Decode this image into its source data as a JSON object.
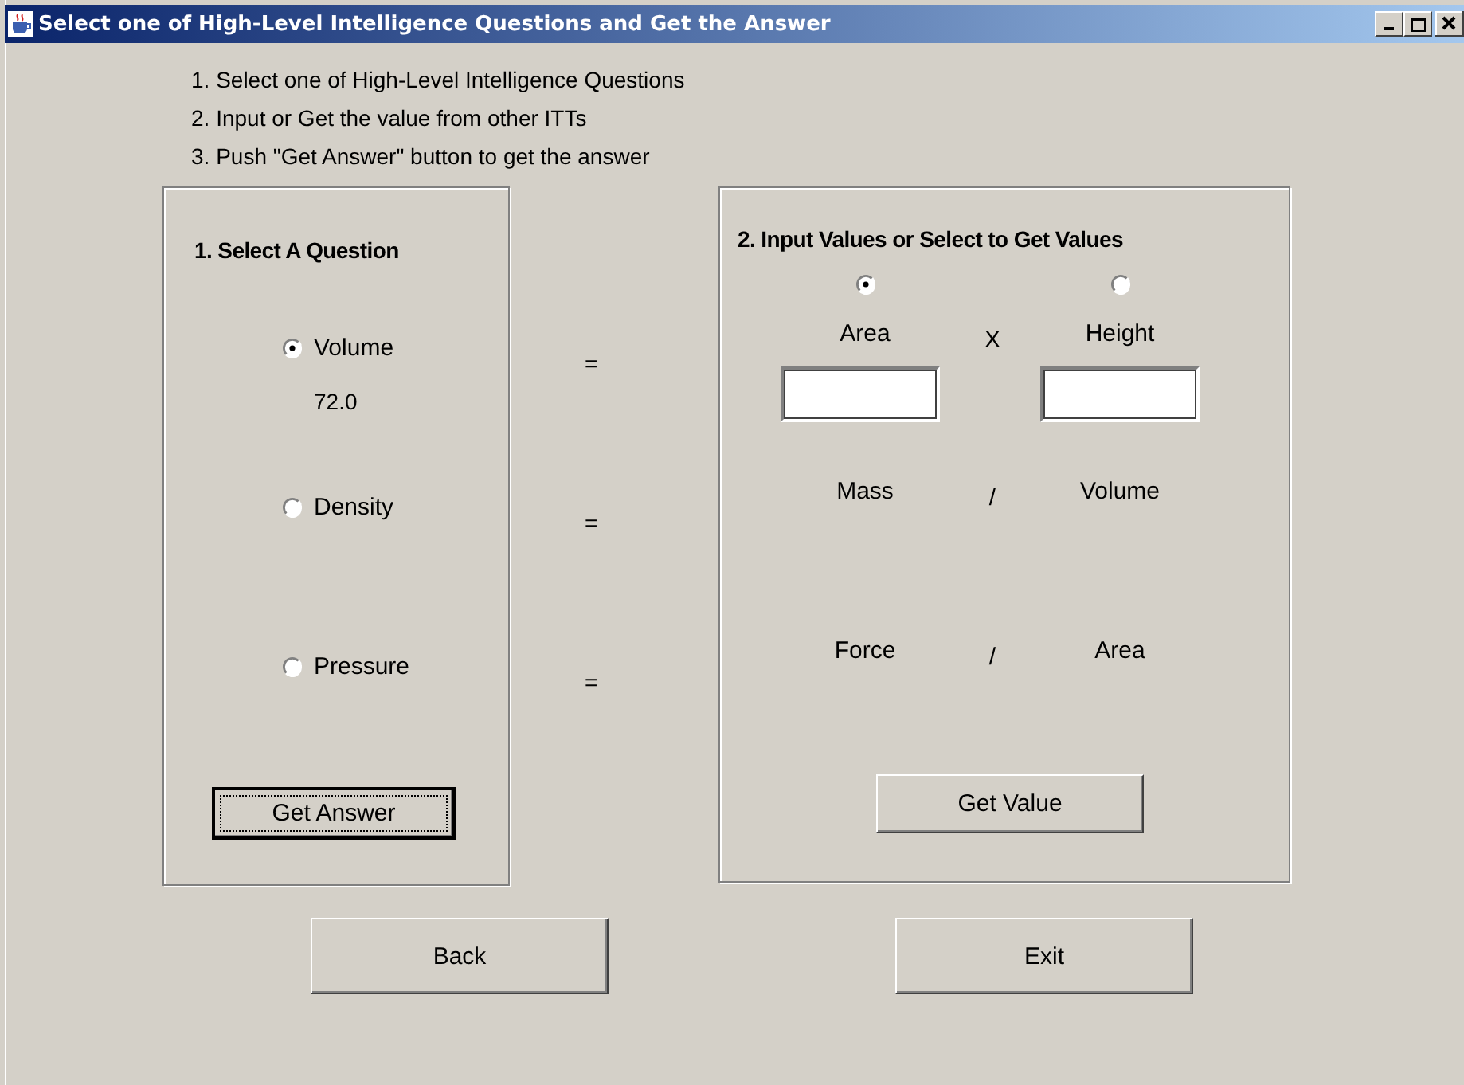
{
  "window": {
    "title": "Select one of High-Level Intelligence Questions and Get the Answer"
  },
  "instructions": [
    "1. Select one of High-Level Intelligence Questions",
    "2. Input or Get the value from other ITTs",
    "3. Push \"Get Answer\" button to get the answer"
  ],
  "question_panel": {
    "title": "1. Select A Question",
    "questions": [
      {
        "label": "Volume",
        "selected": true,
        "answer": "72.0",
        "equals": "="
      },
      {
        "label": "Density",
        "selected": false,
        "equals": "="
      },
      {
        "label": "Pressure",
        "selected": false,
        "equals": "="
      }
    ],
    "button": "Get Answer"
  },
  "values_panel": {
    "title": "2. Input Values or Select to Get Values",
    "formulas": [
      {
        "operator": "X",
        "operands": [
          {
            "label": "Area",
            "kind": "selectable",
            "selected": true
          },
          {
            "label": "Height",
            "kind": "selectable",
            "selected": false
          }
        ]
      },
      {
        "operator": "/",
        "operands": [
          {
            "label": "Mass",
            "kind": "plain"
          },
          {
            "label": "Volume",
            "kind": "plain"
          }
        ]
      },
      {
        "operator": "/",
        "operands": [
          {
            "label": "Force",
            "kind": "plain"
          },
          {
            "label": "Area",
            "kind": "plain"
          }
        ]
      }
    ],
    "button": "Get Value"
  },
  "buttons": [
    "Back",
    "Exit"
  ]
}
